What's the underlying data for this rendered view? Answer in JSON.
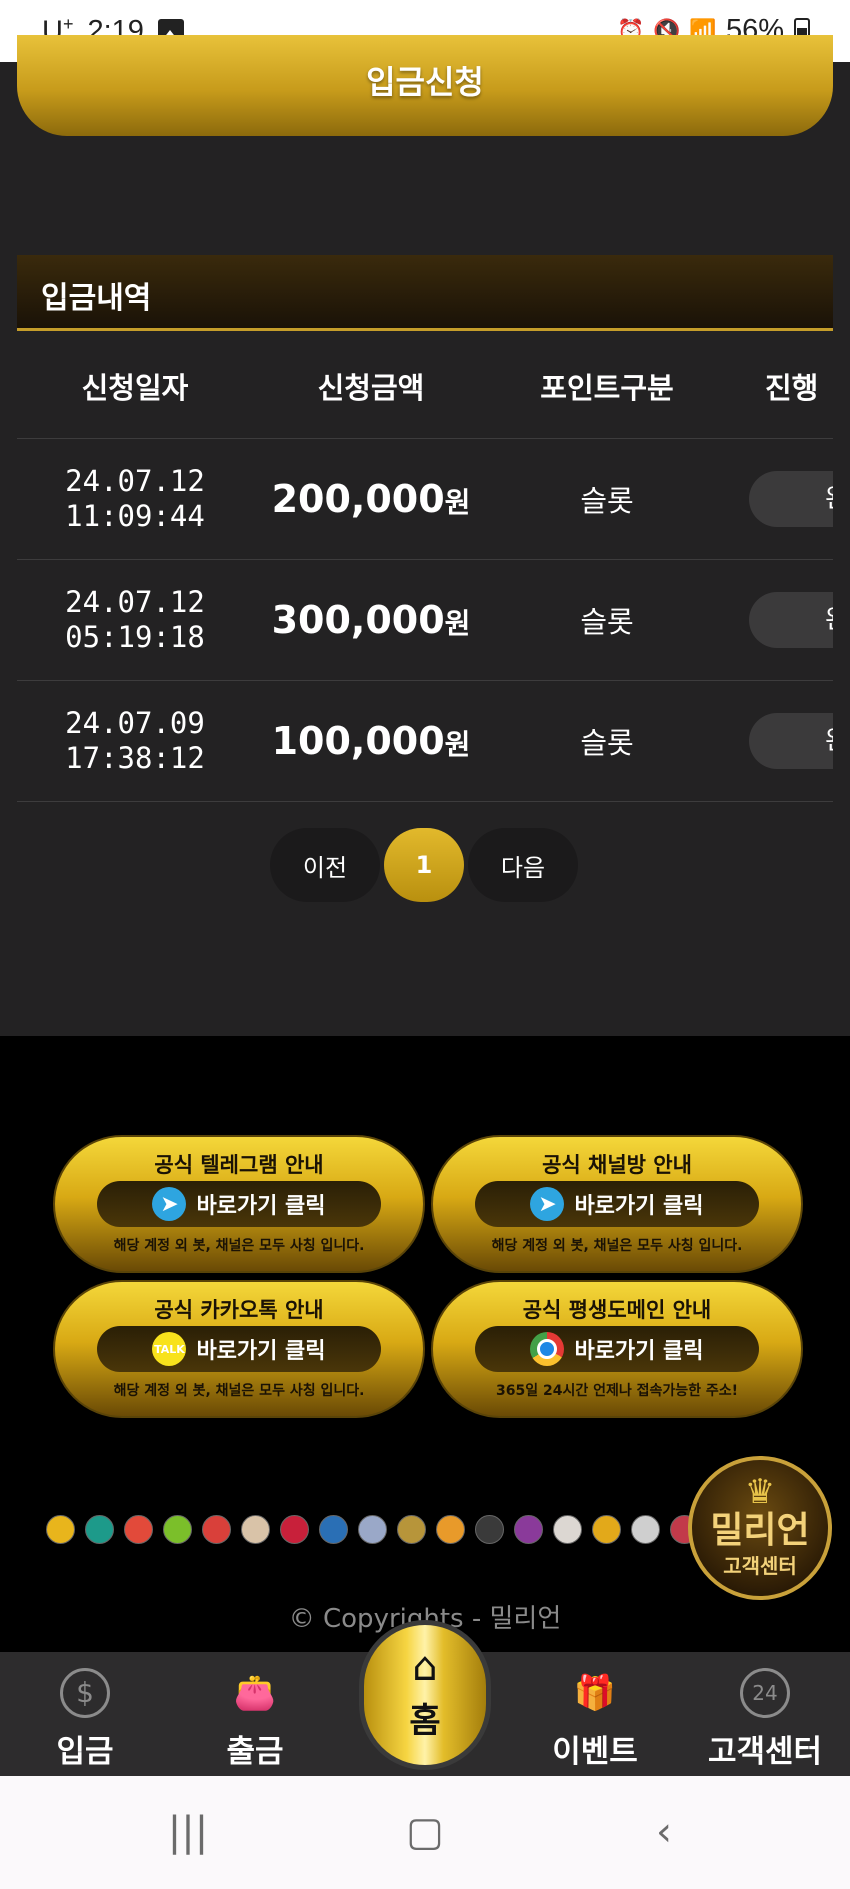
{
  "status_bar": {
    "carrier": "U",
    "carrier_sup": "+",
    "time": "2:19",
    "battery": "56%"
  },
  "top_button": {
    "label": "입금신청"
  },
  "history": {
    "title": "입금내역",
    "columns": [
      "신청일자",
      "신청금액",
      "포인트구분",
      "진행"
    ],
    "rows": [
      {
        "date": "24.07.12",
        "time": "11:09:44",
        "amount": "200,000",
        "unit": "원",
        "point_type": "슬롯",
        "status": "완"
      },
      {
        "date": "24.07.12",
        "time": "05:19:18",
        "amount": "300,000",
        "unit": "원",
        "point_type": "슬롯",
        "status": "완"
      },
      {
        "date": "24.07.09",
        "time": "17:38:12",
        "amount": "100,000",
        "unit": "원",
        "point_type": "슬롯",
        "status": "완"
      }
    ]
  },
  "pagination": {
    "prev": "이전",
    "current": "1",
    "next": "다음"
  },
  "banners": [
    {
      "title": "공식 텔레그램 안내",
      "button": "바로가기 클릭",
      "icon": "telegram-icon",
      "sub": "해당 계정 외 봇, 채널은 모두 사칭 입니다."
    },
    {
      "title": "공식 채널방 안내",
      "button": "바로가기 클릭",
      "icon": "telegram-icon",
      "sub": "해당 계정 외 봇, 채널은 모두 사칭 입니다."
    },
    {
      "title": "공식 카카오톡 안내",
      "button": "바로가기 클릭",
      "icon": "kakaotalk-icon",
      "icon_text": "TALK",
      "sub": "해당 계정 외 봇, 채널은 모두 사칭 입니다."
    },
    {
      "title": "공식 평생도메인 안내",
      "button": "바로가기 클릭",
      "icon": "chrome-icon",
      "sub": "365일 24시간 언제나 접속가능한 주소!"
    }
  ],
  "customer_center_badge": {
    "line1": "밀리언",
    "line2": "고객센터"
  },
  "copyright": "© Copyrights - 밀리언",
  "bottom_nav": {
    "deposit": "입금",
    "withdraw": "출금",
    "home": "홈",
    "event": "이벤트",
    "support": "고객센터",
    "support_icon_text": "24"
  },
  "colors": {
    "gold": "#d8a914",
    "background": "#232223",
    "nav": "#2d2c2d"
  }
}
